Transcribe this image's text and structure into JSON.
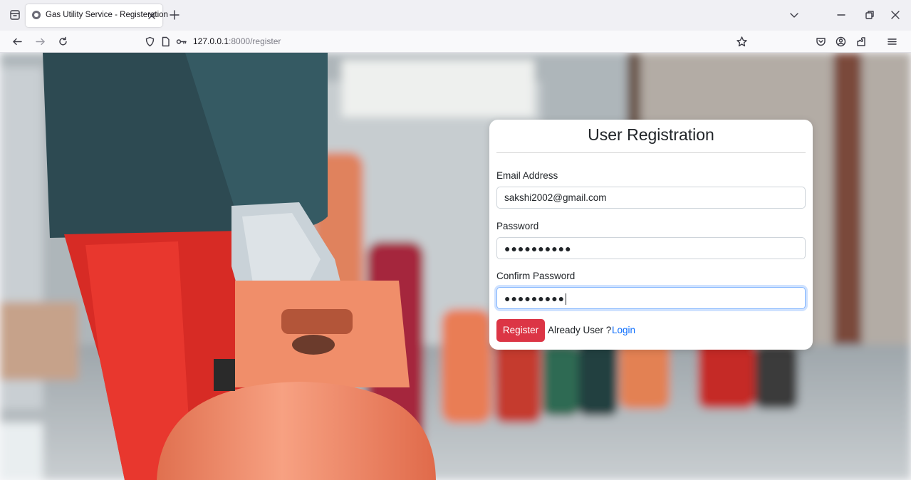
{
  "browser": {
    "tab_title": "Gas Utility Service - Registeration",
    "url_host": "127.0.0.1",
    "url_path": ":8000/register"
  },
  "form": {
    "title": "User Registration",
    "email_label": "Email Address",
    "email_value": "sakshi2002@gmail.com",
    "password_label": "Password",
    "password_mask": "●●●●●●●●●●",
    "confirm_label": "Confirm Password",
    "confirm_mask": "●●●●●●●●●",
    "register_label": "Register",
    "already_text": "Already User ?",
    "login_label": "Login"
  },
  "colors": {
    "register_button": "#dc3545",
    "login_link": "#0d6efd",
    "focus_ring": "#86b7fe"
  }
}
